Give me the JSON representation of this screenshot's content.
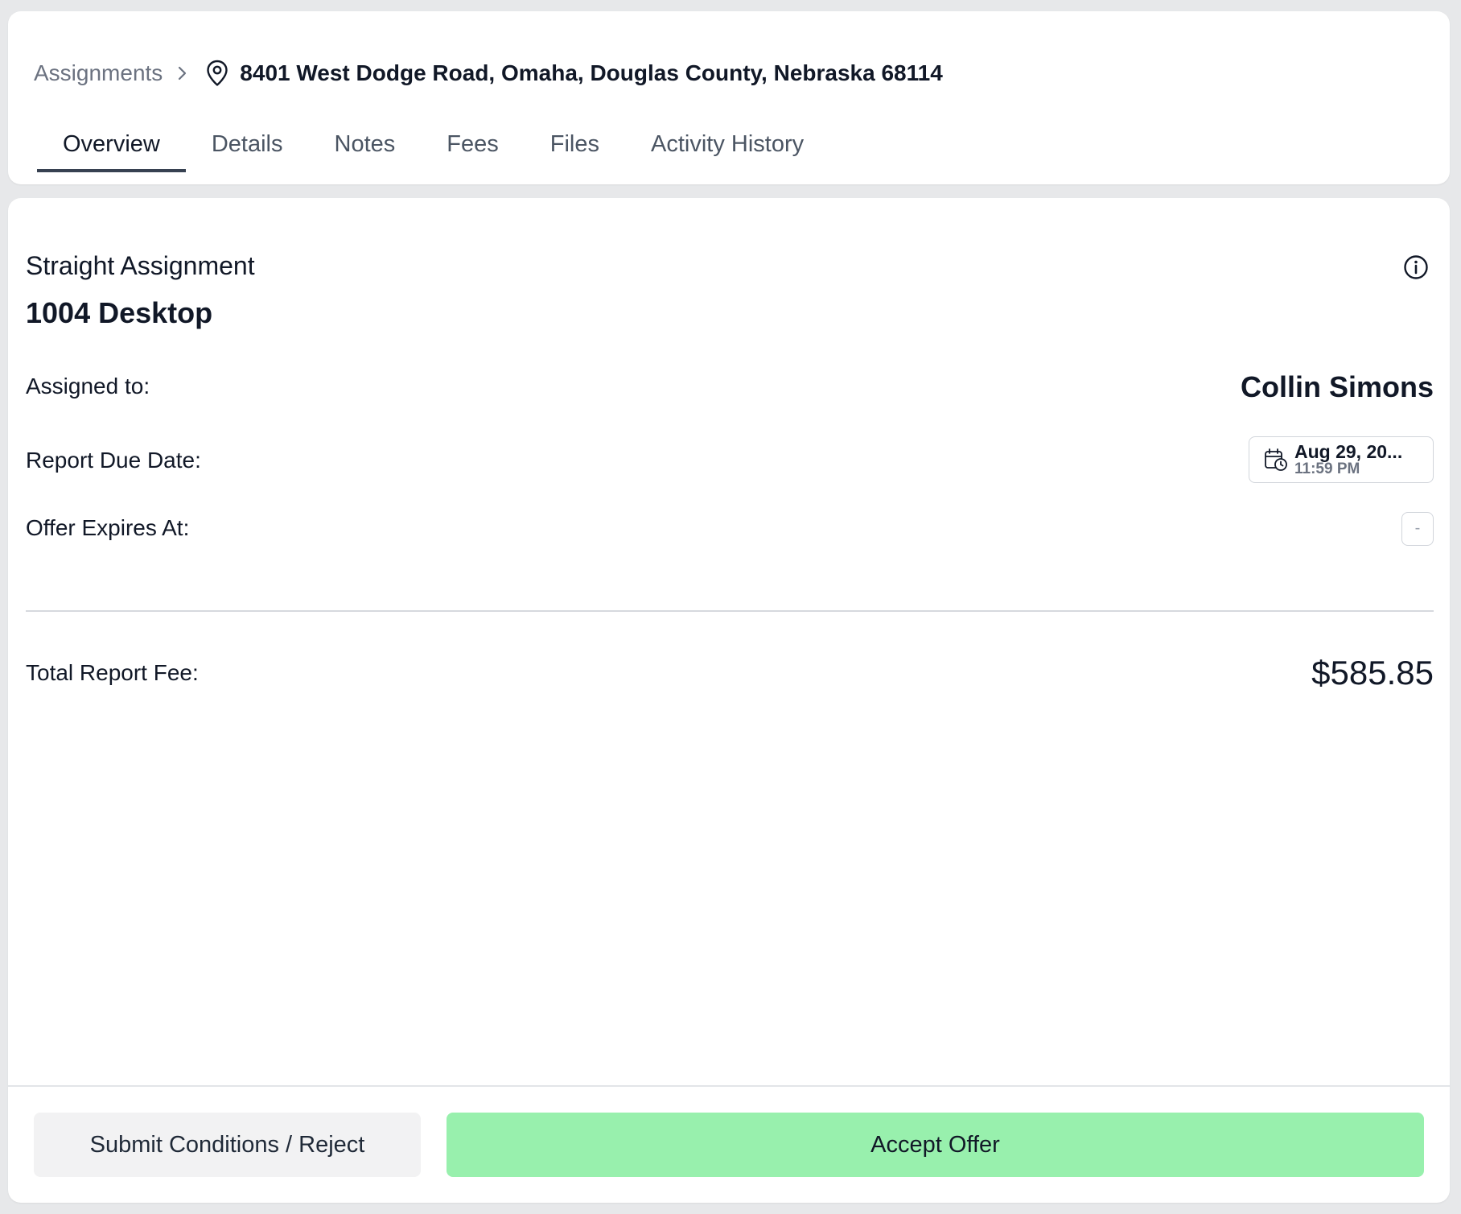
{
  "breadcrumb": {
    "root": "Assignments",
    "address": "8401 West Dodge Road, Omaha, Douglas County, Nebraska 68114"
  },
  "tabs": [
    {
      "label": "Overview",
      "active": true
    },
    {
      "label": "Details"
    },
    {
      "label": "Notes"
    },
    {
      "label": "Fees"
    },
    {
      "label": "Files"
    },
    {
      "label": "Activity History"
    }
  ],
  "assignment": {
    "type": "Straight Assignment",
    "product": "1004 Desktop",
    "assigned_label": "Assigned to:",
    "assignee": "Collin Simons",
    "due_label": "Report Due Date:",
    "due_date": "Aug 29, 20...",
    "due_time": "11:59 PM",
    "expires_label": "Offer Expires At:",
    "expires_value": "-",
    "fee_label": "Total Report Fee:",
    "fee_amount": "$585.85"
  },
  "actions": {
    "reject_label": "Submit Conditions / Reject",
    "accept_label": "Accept Offer"
  },
  "colors": {
    "accent": "#98f0ad",
    "background": "#e7e8ea",
    "tab_indicator": "#374151"
  },
  "icons": {
    "separator": "chevron-right-icon",
    "location": "map-pin-icon",
    "info": "info-circle-icon",
    "calendar": "calendar-clock-icon"
  }
}
